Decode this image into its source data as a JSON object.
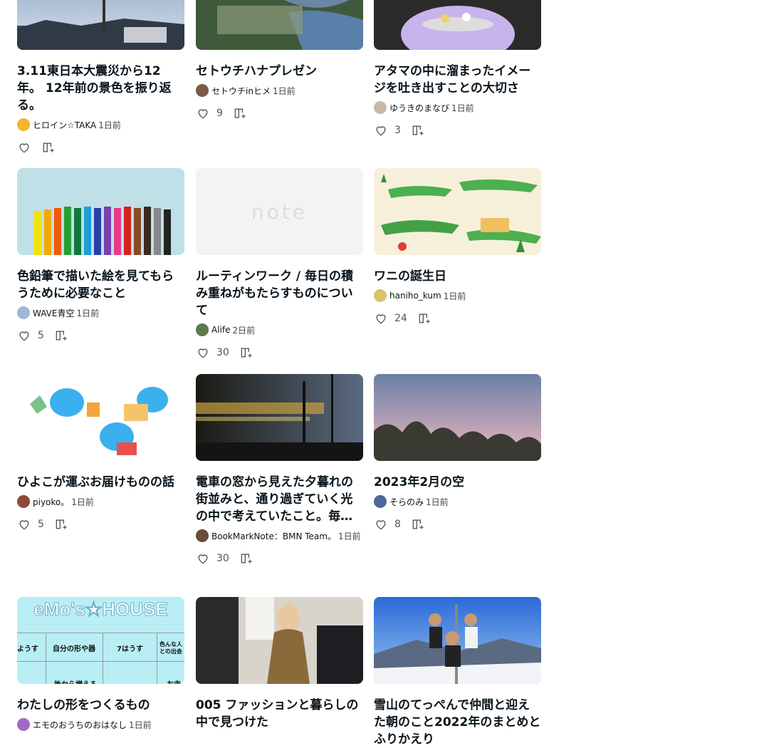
{
  "cards": [
    {
      "title": "3.11東日本大震災から12年。 12年前の景色を振り返る。",
      "creator": "ヒロイン☆TAKA",
      "time": "1日前",
      "likes": "",
      "avatar_color": "#f5b52e"
    },
    {
      "title": "セトウチハナプレゼン",
      "creator": "セトウチinヒメ",
      "time": "1日前",
      "likes": "9",
      "avatar_color": "#7a5b4a"
    },
    {
      "title": "アタマの中に溜まったイメージを吐き出すことの大切さ",
      "creator": "ゆうきのまなび",
      "time": "1日前",
      "likes": "3",
      "avatar_color": "#c9b8a8"
    },
    {
      "title": "色鉛筆で描いた絵を見てもらうために必要なこと",
      "creator": "WAVE青空",
      "time": "1日前",
      "likes": "5",
      "avatar_color": "#9fb8d8"
    },
    {
      "title": "ルーティンワーク / 毎日の積み重ねがもたらすものについて",
      "creator": "Alife",
      "time": "2日前",
      "likes": "30",
      "avatar_color": "#5c7b4e"
    },
    {
      "title": "ワニの誕生日",
      "creator": "haniho_kum",
      "time": "1日前",
      "likes": "24",
      "avatar_color": "#d9c46a"
    },
    {
      "title": "ひよこが運ぶお届けものの話",
      "creator": "piyoko。",
      "time": "1日前",
      "likes": "5",
      "avatar_color": "#8a4a3a"
    },
    {
      "title": "電車の窓から見えた夕暮れの街並みと、通り過ぎていく光の中で考えていたこと。毎日同じ景色なのに同じ日は一度もないという話を、少しだけ書いておきたい",
      "creator": "BookMarkNote：BMN Team。",
      "time": "1日前",
      "likes": "30",
      "avatar_color": "#6a4a3a"
    },
    {
      "title": "2023年2月の空",
      "creator": "そらのみ",
      "time": "1日前",
      "likes": "8",
      "avatar_color": "#4a6a9a"
    },
    {
      "title": "わたしの形をつくるもの",
      "creator": "エモのおうちのおはなし",
      "time": "1日前",
      "likes": "",
      "avatar_color": "#a06ac8"
    },
    {
      "title": "005 ファッションと暮らしの中で見つけた",
      "creator": "",
      "time": "",
      "likes": "",
      "avatar_color": "#888888"
    },
    {
      "title": "雪山のてっぺんで仲間と迎えた朝のこと2022年のまとめとふりかえり",
      "creator": "",
      "time": "",
      "likes": "",
      "avatar_color": "#888888"
    }
  ],
  "images": {
    "eleven_text": "eMo's★HOUSE",
    "eleven_cells": [
      "ようす",
      "自分の形や器",
      "7はうす",
      "色んな人との出会"
    ],
    "eleven_bottom": [
      "後から増える",
      "お寺"
    ],
    "note_logo": "note"
  }
}
